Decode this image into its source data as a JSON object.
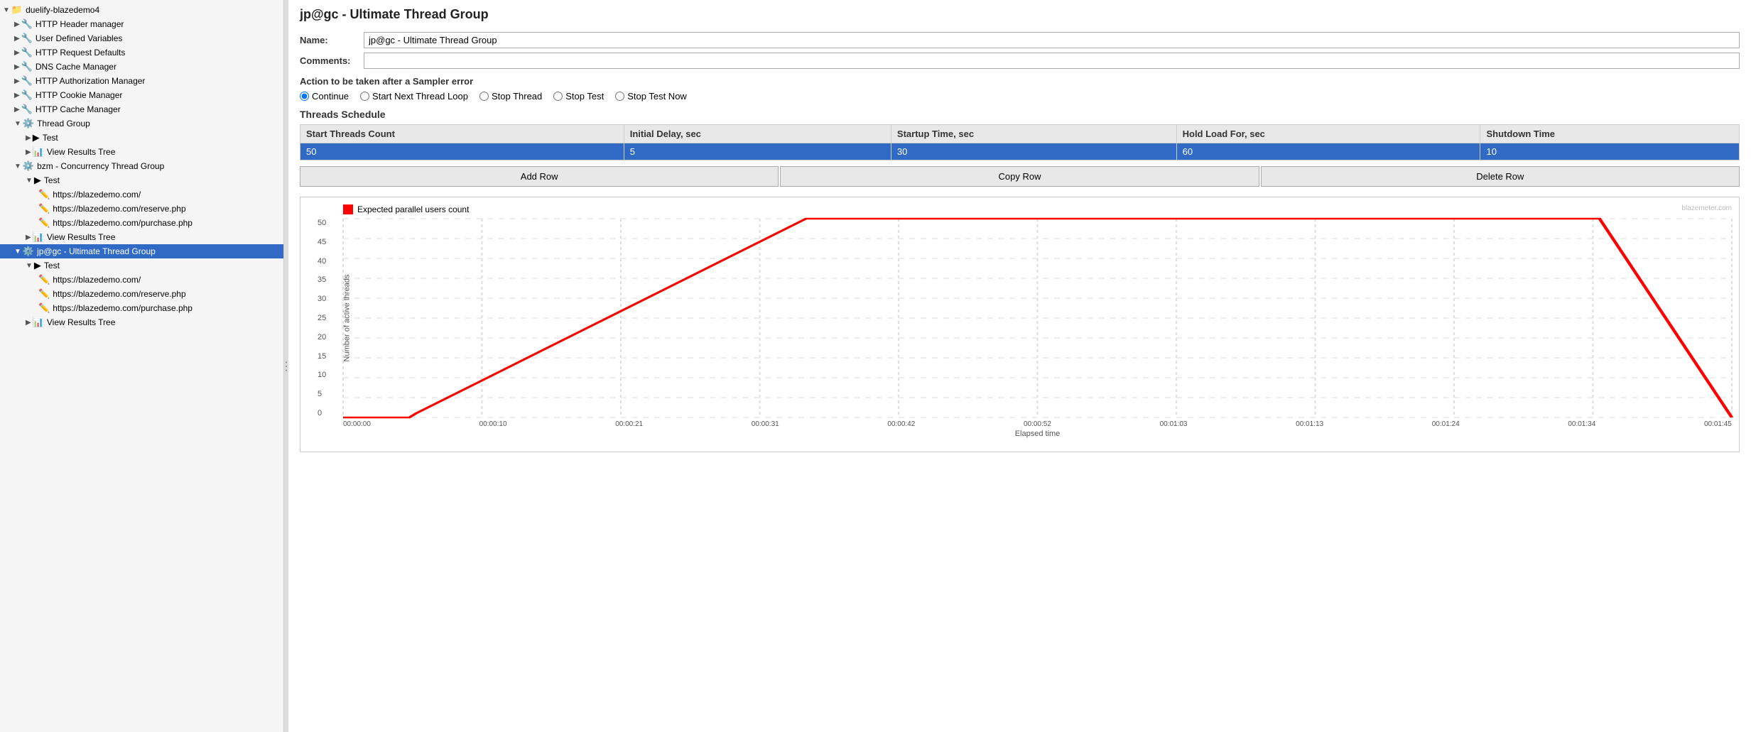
{
  "sidebar": {
    "items": [
      {
        "id": "duelify-blazedemo4",
        "label": "duelify-blazedemo4",
        "level": 0,
        "icon": "📁",
        "expanded": true,
        "selected": false
      },
      {
        "id": "http-header-manager",
        "label": "HTTP Header manager",
        "level": 1,
        "icon": "🔧",
        "selected": false
      },
      {
        "id": "user-defined-variables",
        "label": "User Defined Variables",
        "level": 1,
        "icon": "🔧",
        "selected": false
      },
      {
        "id": "http-request-defaults",
        "label": "HTTP Request Defaults",
        "level": 1,
        "icon": "🔧",
        "selected": false
      },
      {
        "id": "dns-cache-manager",
        "label": "DNS Cache Manager",
        "level": 1,
        "icon": "🔧",
        "selected": false
      },
      {
        "id": "http-auth-manager",
        "label": "HTTP Authorization Manager",
        "level": 1,
        "icon": "🔧",
        "selected": false
      },
      {
        "id": "http-cookie-manager",
        "label": "HTTP Cookie Manager",
        "level": 1,
        "icon": "🔧",
        "selected": false
      },
      {
        "id": "http-cache-manager",
        "label": "HTTP Cache Manager",
        "level": 1,
        "icon": "🔧",
        "selected": false
      },
      {
        "id": "thread-group",
        "label": "Thread Group",
        "level": 1,
        "icon": "⚙️",
        "expanded": true,
        "selected": false
      },
      {
        "id": "test1",
        "label": "Test",
        "level": 2,
        "icon": "▶",
        "selected": false
      },
      {
        "id": "view-results-tree1",
        "label": "View Results Tree",
        "level": 2,
        "icon": "📊",
        "selected": false
      },
      {
        "id": "bzm-concurrency",
        "label": "bzm - Concurrency Thread Group",
        "level": 1,
        "icon": "⚙️",
        "expanded": true,
        "selected": false
      },
      {
        "id": "test2",
        "label": "Test",
        "level": 2,
        "icon": "▶",
        "expanded": true,
        "selected": false
      },
      {
        "id": "blazedemo1",
        "label": "https://blazedemo.com/",
        "level": 3,
        "icon": "✏️",
        "selected": false
      },
      {
        "id": "blazedemo-reserve",
        "label": "https://blazedemo.com/reserve.php",
        "level": 3,
        "icon": "✏️",
        "selected": false
      },
      {
        "id": "blazedemo-purchase",
        "label": "https://blazedemo.com/purchase.php",
        "level": 3,
        "icon": "✏️",
        "selected": false
      },
      {
        "id": "view-results-tree2",
        "label": "View Results Tree",
        "level": 2,
        "icon": "📊",
        "selected": false
      },
      {
        "id": "jp-ultimate-group",
        "label": "jp@gc - Ultimate Thread Group",
        "level": 1,
        "icon": "⚙️",
        "expanded": true,
        "selected": true
      },
      {
        "id": "test3",
        "label": "Test",
        "level": 2,
        "icon": "▶",
        "expanded": true,
        "selected": false
      },
      {
        "id": "blazedemo2",
        "label": "https://blazedemo.com/",
        "level": 3,
        "icon": "✏️",
        "selected": false
      },
      {
        "id": "blazedemo-reserve2",
        "label": "https://blazedemo.com/reserve.php",
        "level": 3,
        "icon": "✏️",
        "selected": false
      },
      {
        "id": "blazedemo-purchase2",
        "label": "https://blazedemo.com/purchase.php",
        "level": 3,
        "icon": "✏️",
        "selected": false
      },
      {
        "id": "view-results-tree3",
        "label": "View Results Tree",
        "level": 2,
        "icon": "📊",
        "selected": false
      }
    ]
  },
  "main": {
    "title": "jp@gc - Ultimate Thread Group",
    "name_label": "Name:",
    "name_value": "jp@gc - Ultimate Thread Group",
    "comments_label": "Comments:",
    "comments_value": "",
    "action_label": "Action to be taken after a Sampler error",
    "radio_options": [
      {
        "id": "continue",
        "label": "Continue",
        "checked": true
      },
      {
        "id": "start-next-thread-loop",
        "label": "Start Next Thread Loop",
        "checked": false
      },
      {
        "id": "stop-thread",
        "label": "Stop Thread",
        "checked": false
      },
      {
        "id": "stop-test",
        "label": "Stop Test",
        "checked": false
      },
      {
        "id": "stop-test-now",
        "label": "Stop Test Now",
        "checked": false
      }
    ],
    "threads_schedule_title": "Threads Schedule",
    "table": {
      "columns": [
        "Start Threads Count",
        "Initial Delay, sec",
        "Startup Time, sec",
        "Hold Load For, sec",
        "Shutdown Time"
      ],
      "rows": [
        {
          "start_threads": "50",
          "initial_delay": "5",
          "startup_time": "30",
          "hold_load": "60",
          "shutdown_time": "10",
          "selected": true
        }
      ]
    },
    "buttons": {
      "add_row": "Add Row",
      "copy_row": "Copy Row",
      "delete_row": "Delete Row"
    },
    "chart": {
      "legend_label": "Expected parallel users count",
      "y_axis_label": "Number of active threads",
      "x_axis_title": "Elapsed time",
      "watermark": "blazemeter.com",
      "y_ticks": [
        0,
        5,
        10,
        15,
        20,
        25,
        30,
        35,
        40,
        45,
        50
      ],
      "x_labels": [
        "00:00:00",
        "00:00:10",
        "00:00:21",
        "00:00:31",
        "00:00:42",
        "00:00:52",
        "00:01:03",
        "00:01:13",
        "00:01:24",
        "00:01:34",
        "00:01:45"
      ]
    }
  }
}
